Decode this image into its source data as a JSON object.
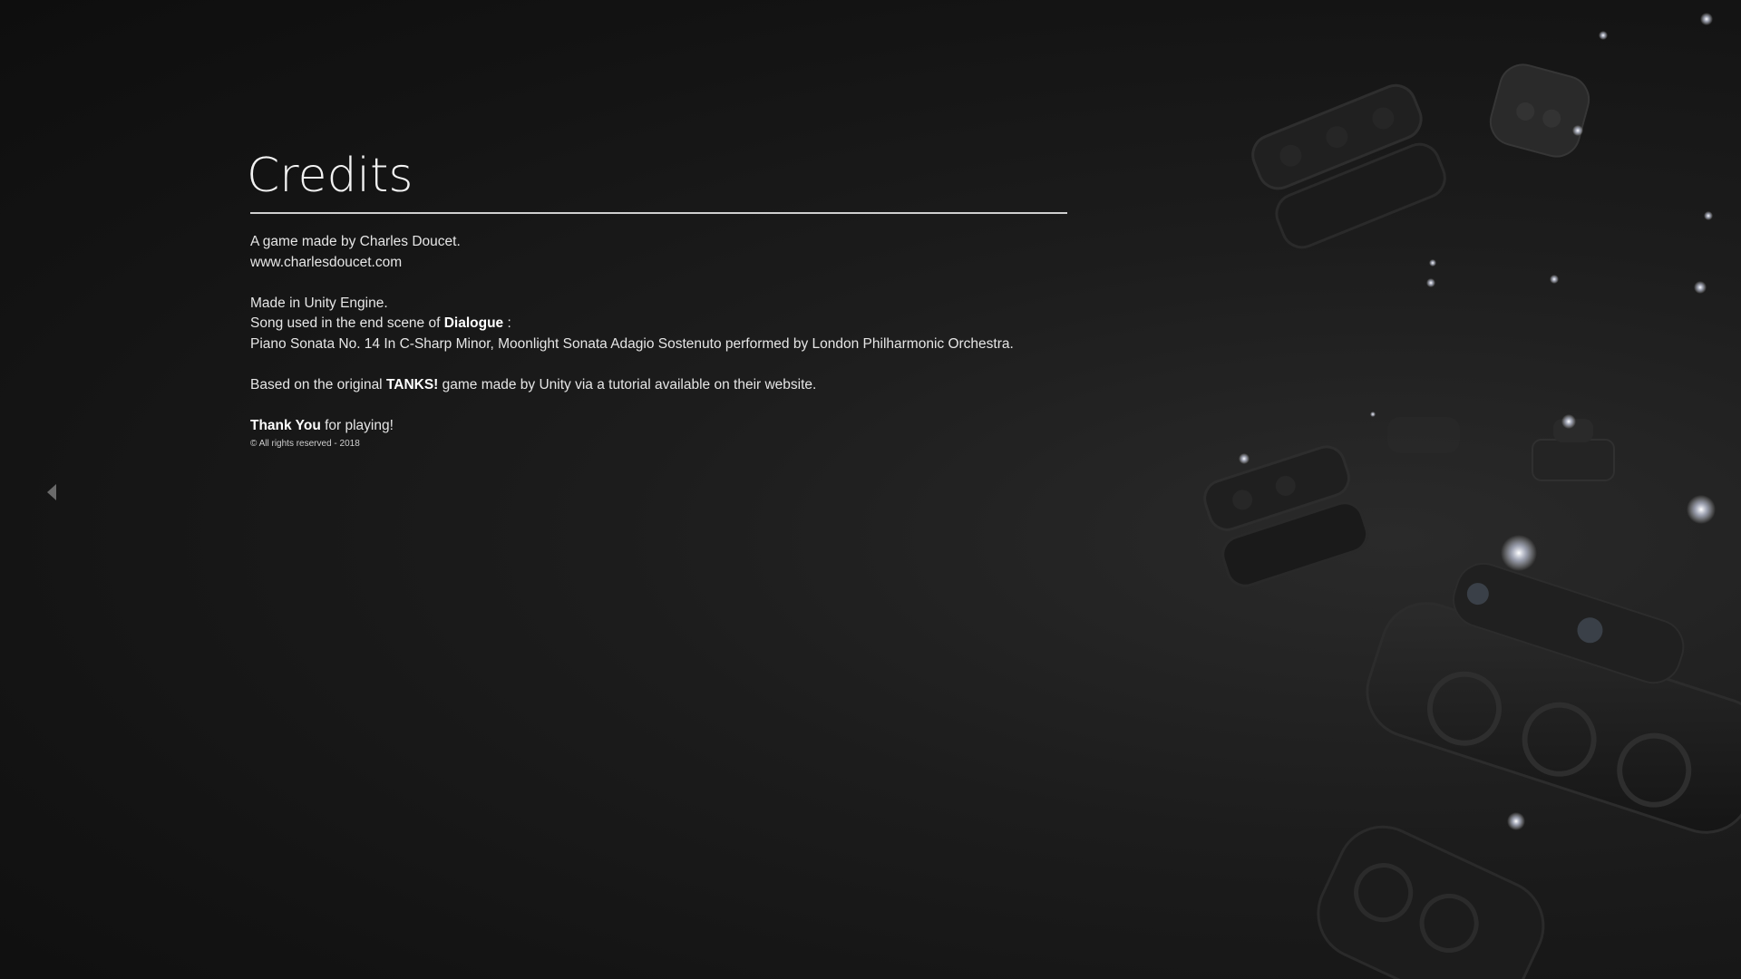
{
  "credits": {
    "title": "Credits",
    "line_author": "A game made by Charles Doucet.",
    "line_website": "www.charlesdoucet.com",
    "line_engine": "Made in Unity Engine.",
    "line_song_prefix": "Song used in the end scene of ",
    "line_song_scene": "Dialogue",
    "line_song_suffix": " :",
    "line_song_title": "Piano Sonata No. 14 In C-Sharp Minor, Moonlight Sonata Adagio Sostenuto performed by London Philharmonic Orchestra.",
    "line_based_prefix": "Based on the original ",
    "line_based_game": "TANKS!",
    "line_based_suffix": " game made by Unity via a tutorial available on their website.",
    "line_thanks_bold": "Thank You",
    "line_thanks_rest": " for playing!",
    "copyright": "© All rights reserved - 2018"
  },
  "navigation": {
    "back_icon": "triangle-left-icon"
  },
  "colors": {
    "background": "#151515",
    "text": "#e8e8e8",
    "divider": "#cfcfcf"
  }
}
